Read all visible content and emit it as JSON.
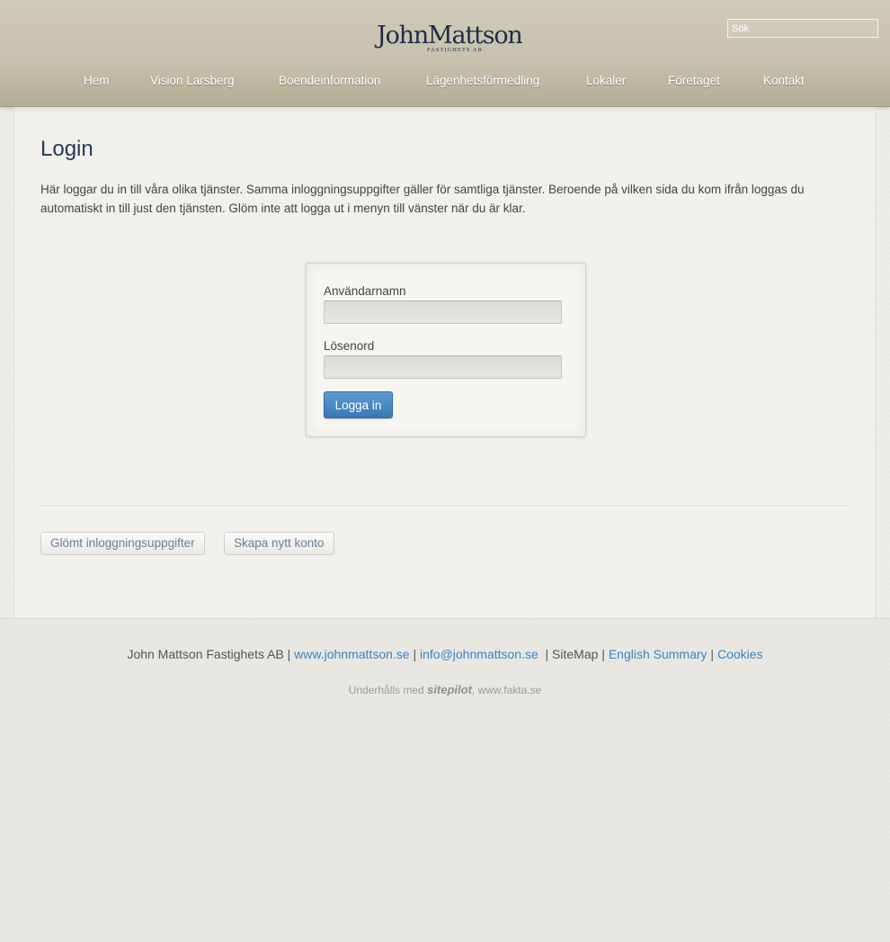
{
  "header": {
    "logo": {
      "main": "JohnMattson",
      "sub": "FASTIGHETS AB"
    },
    "search_placeholder": "Sök",
    "nav": [
      {
        "label": "Hem"
      },
      {
        "label": "Vision Larsberg"
      },
      {
        "label": "Boendeinformation"
      },
      {
        "label": "Lägenhetsförmedling"
      },
      {
        "label": "Lokaler"
      },
      {
        "label": "Företaget"
      },
      {
        "label": "Kontakt"
      }
    ]
  },
  "main": {
    "title": "Login",
    "intro": "Här loggar du in till våra olika tjänster. Samma inloggningsuppgifter gäller för samtliga tjänster. Beroende på vilken sida du kom ifrån loggas du automatiskt in till just den tjänsten. Glöm inte att logga ut i menyn till vänster när du är klar.",
    "login_form": {
      "username_label": "Användarnamn",
      "username_value": "",
      "password_label": "Lösenord",
      "password_value": "",
      "submit_label": "Logga in"
    },
    "links": {
      "forgot": "Glömt inloggningsuppgifter",
      "create": "Skapa nytt konto"
    }
  },
  "footer": {
    "company": "John Mattson Fastighets AB |",
    "website": "www.johnmattson.se",
    "sep1": "|",
    "email": "info@johnmattson.se",
    "sitemap": "| SiteMap |",
    "english": "English Summary",
    "sep2": "|",
    "cookies": "Cookies",
    "credit_prefix": "Underhålls med",
    "credit_brand": "sitepilot",
    "credit_suffix": ", www.fakta.se"
  },
  "colors": {
    "header_bg": "#c6c2ad",
    "title": "#1e3a5c",
    "link": "#3d84c4",
    "button": "#3979b6"
  }
}
